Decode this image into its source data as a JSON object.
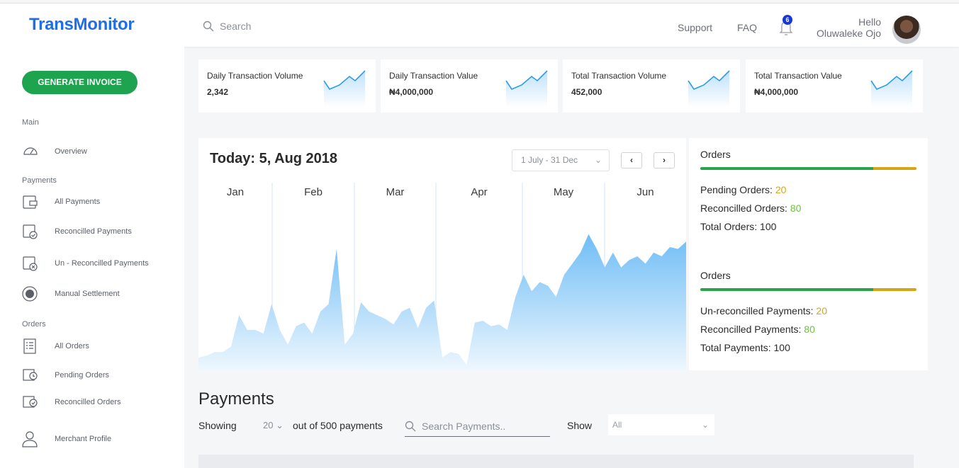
{
  "header": {
    "brand": "TransMonitor",
    "search_placeholder": "Search",
    "links": [
      "Support",
      "FAQ"
    ],
    "notification_count": "6",
    "greeting": "Hello",
    "user_name": "Oluwaleke Ojo"
  },
  "sidebar": {
    "generate_button": "GENERATE INVOICE",
    "sections": [
      {
        "label": "Main",
        "items": [
          {
            "label": "Overview",
            "icon": "gauge-icon"
          }
        ]
      },
      {
        "label": "Payments",
        "items": [
          {
            "label": "All Payments",
            "icon": "payments-icon"
          },
          {
            "label": "Reconcilled Payments",
            "icon": "reconciled-payments-icon"
          },
          {
            "label": "Un - Reconcilled Payments",
            "icon": "unreconciled-payments-icon"
          },
          {
            "label": "Manual Settlement",
            "icon": "radio-icon"
          }
        ]
      },
      {
        "label": "Orders",
        "items": [
          {
            "label": "All Orders",
            "icon": "orders-icon"
          },
          {
            "label": "Pending Orders",
            "icon": "pending-orders-icon"
          },
          {
            "label": "Reconcilled Orders",
            "icon": "reconciled-orders-icon"
          }
        ]
      }
    ],
    "merchant_profile": "Merchant Profile"
  },
  "kpis": [
    {
      "title": "Daily Transaction Volume",
      "value": "2,342"
    },
    {
      "title": "Daily Transaction Value",
      "value": "₦4,000,000"
    },
    {
      "title": "Total Transaction Volume",
      "value": "452,000"
    },
    {
      "title": "Total Transaction Value",
      "value": "₦4,000,000"
    }
  ],
  "chart_panel": {
    "today": "Today: 5, Aug 2018",
    "range": "1 July - 31 Dec",
    "prev": "‹",
    "next": "›"
  },
  "chart_data": {
    "type": "area",
    "categories": [
      "Jan",
      "Feb",
      "Mar",
      "Apr",
      "May",
      "Jun"
    ],
    "series": [
      {
        "values": [
          5,
          6,
          8,
          8,
          11,
          28,
          20,
          20,
          18,
          34,
          20,
          12,
          22,
          24,
          18,
          30,
          34,
          64,
          12,
          18,
          35,
          30,
          28,
          26,
          23,
          30,
          32,
          21,
          32,
          36,
          5,
          8,
          7,
          1,
          24,
          25,
          22,
          23,
          20,
          38,
          50,
          41,
          46,
          44,
          38,
          50,
          56,
          62,
          72,
          64,
          54,
          62,
          54,
          58,
          60,
          56,
          62,
          60,
          65,
          64,
          68
        ]
      }
    ]
  },
  "orders_panel": {
    "block1": {
      "title": "Orders",
      "lines": [
        {
          "label": "Pending Orders: ",
          "value": "20",
          "tone": "yellow"
        },
        {
          "label": "Reconcilled Orders: ",
          "value": "80",
          "tone": "green"
        },
        {
          "label": "Total Orders: ",
          "value": "100",
          "tone": "plain"
        }
      ],
      "split": {
        "green": 0.8,
        "yellow": 0.2
      }
    },
    "block2": {
      "title": "Orders",
      "lines": [
        {
          "label": "Un-reconcilled Payments: ",
          "value": "20",
          "tone": "yellow"
        },
        {
          "label": "Reconcilled Payments: ",
          "value": "80",
          "tone": "green"
        },
        {
          "label": "Total Payments: ",
          "value": "100",
          "tone": "plain"
        }
      ],
      "split": {
        "green": 0.8,
        "yellow": 0.2
      }
    }
  },
  "payments": {
    "title": "Payments",
    "showing_label": "Showing",
    "page_size": "20",
    "out_of": "out of 500 payments",
    "search_placeholder": "Search Payments..",
    "show_label": "Show",
    "show_value": "All"
  },
  "colors": {
    "brand": "#1f6ee8",
    "generate_button": "#1ea34f",
    "chart_fill": "#7cc3f7",
    "bar_green": "#2ba24c",
    "bar_yellow": "#d4a514"
  }
}
